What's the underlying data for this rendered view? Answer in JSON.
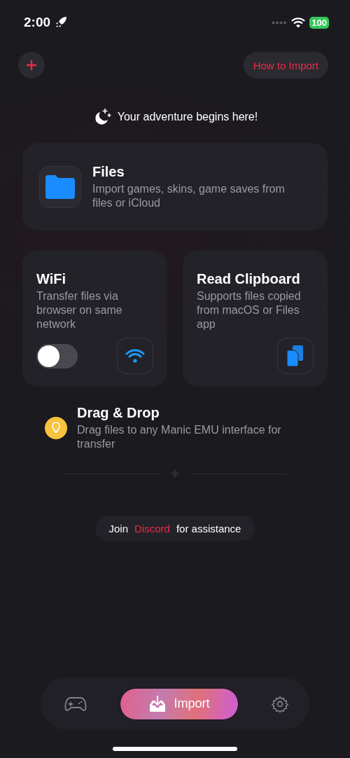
{
  "status_bar": {
    "time": "2:00",
    "battery": "100"
  },
  "header": {
    "help_link": "How to Import"
  },
  "tagline": "Your adventure begins here!",
  "files_card": {
    "title": "Files",
    "description": "Import games, skins, game saves from files or iCloud"
  },
  "option_cards": [
    {
      "kind": "wifi",
      "title": "WiFi",
      "description": "Transfer files via browser on same network",
      "on": false
    },
    {
      "kind": "clipboard",
      "title": "Read Clipboard",
      "description": "Supports files copied from macOS or Files app"
    }
  ],
  "tip": {
    "title": "Drag & Drop",
    "description": "Drag files to any Manic EMU interface for transfer"
  },
  "help": {
    "prefix": "Join",
    "link": "Discord",
    "suffix": "for assistance"
  },
  "tab_bar": [
    {
      "kind": "games",
      "selected": false
    },
    {
      "kind": "import",
      "label": "Import",
      "selected": true
    },
    {
      "kind": "settings",
      "selected": false
    }
  ]
}
